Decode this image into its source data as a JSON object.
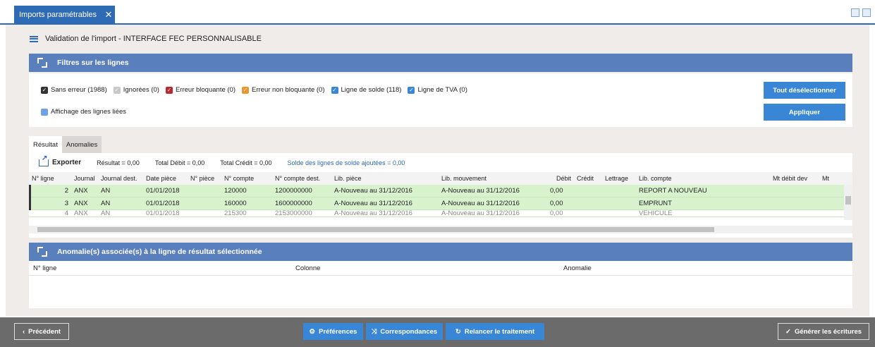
{
  "tab": {
    "label": "Imports paramétrables",
    "close": "✕"
  },
  "header": {
    "title": "Validation de l'import - INTERFACE FEC PERSONNALISABLE"
  },
  "filters": {
    "title": "Filtres sur les lignes",
    "checkboxes": [
      {
        "label": "Sans erreur (1988)",
        "color": "#333333"
      },
      {
        "label": "Ignorées (0)",
        "color": "#c8c8c8"
      },
      {
        "label": "Erreur bloquante (0)",
        "color": "#c0272d"
      },
      {
        "label": "Erreur non bloquante (0)",
        "color": "#f0932b"
      },
      {
        "label": "Ligne de solde (118)",
        "color": "#3a86d6"
      },
      {
        "label": "Ligne de TVA (0)",
        "color": "#3a86d6"
      }
    ],
    "linked": "Affichage des lignes liées",
    "deselect_all": "Tout désélectionner",
    "apply": "Appliquer"
  },
  "result_tabs": [
    "Résultat",
    "Anomalies"
  ],
  "toolbar": {
    "export": "Exporter",
    "result": "Résultat = 0,00",
    "total_debit": "Total Débit = 0,00",
    "total_credit": "Total Crédit = 0,00",
    "solde": "Solde des lignes de solde ajoutées = 0,00"
  },
  "grid": {
    "columns": [
      "N° ligne",
      "Journal",
      "Journal dest.",
      "Date pièce",
      "N° pièce",
      "N° compte",
      "N° compte dest.",
      "Lib. pièce",
      "Lib. mouvement",
      "Débit",
      "Crédit",
      "Lettrage",
      "Lib. compte",
      "Mt débit dev",
      "Mt"
    ],
    "rows": [
      [
        "2",
        "ANX",
        "AN",
        "01/01/2018",
        "",
        "120000",
        "1200000000",
        "A-Nouveau au 31/12/2016",
        "A-Nouveau au 31/12/2016",
        "0,00",
        "",
        "",
        "REPORT A NOUVEAU",
        "",
        ""
      ],
      [
        "3",
        "ANX",
        "AN",
        "01/01/2018",
        "",
        "160000",
        "1600000000",
        "A-Nouveau au 31/12/2016",
        "A-Nouveau au 31/12/2016",
        "0,00",
        "",
        "",
        "EMPRUNT",
        "",
        ""
      ],
      [
        "4",
        "ANX",
        "AN",
        "01/01/2018",
        "",
        "215300",
        "2153000000",
        "A-Nouveau au 31/12/2016",
        "A-Nouveau au 31/12/2016",
        "0,00",
        "",
        "",
        "VEHICULE",
        "",
        ""
      ]
    ]
  },
  "anomalies": {
    "title": "Anomalie(s) associée(s) à la ligne de résultat sélectionnée",
    "columns": [
      "N° ligne",
      "Colonne",
      "Anomalie"
    ]
  },
  "footer": {
    "previous": "Précédent",
    "preferences": "Préférences",
    "mappings": "Correspondances",
    "rerun": "Relancer le traitement",
    "generate": "Générer les écritures"
  }
}
